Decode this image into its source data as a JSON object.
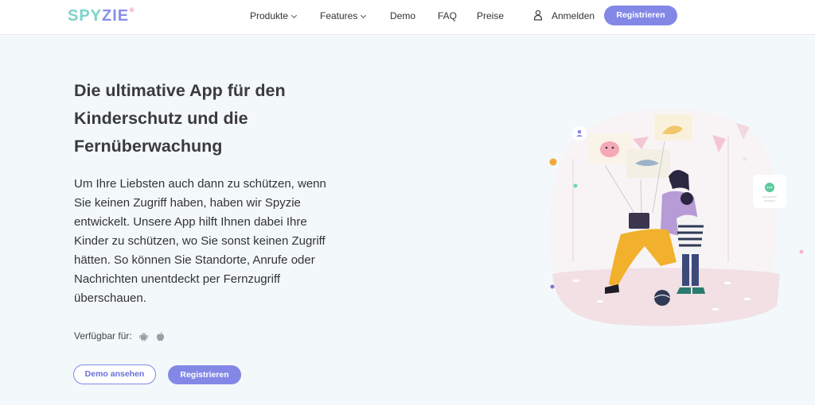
{
  "header": {
    "logo_part1": "SPY",
    "logo_part2": "ZIE",
    "logo_mark": "®",
    "nav": [
      {
        "label": "Produkte",
        "dropdown": true
      },
      {
        "label": "Features",
        "dropdown": true
      },
      {
        "label": "Demo",
        "dropdown": false
      },
      {
        "label": "FAQ",
        "dropdown": false
      },
      {
        "label": "Preise",
        "dropdown": false
      }
    ],
    "login_label": "Anmelden",
    "login_icon": "user-icon",
    "register_label": "Registrieren"
  },
  "hero": {
    "title_lines": [
      "Die ultimative App für den",
      "Kinderschutz und die",
      "Fernüberwachung"
    ],
    "text_lines": [
      "Um Ihre Liebsten auch dann zu schützen, wenn",
      "Sie keinen Zugriff haben, haben wir Spyzie",
      "entwickelt. Unsere App hilft Ihnen dabei Ihre",
      "Kinder zu schützen, wo Sie sonst keinen Zugriff",
      "hätten. So können Sie Standorte, Anrufe oder",
      "Nachrichten unentdeckt per Fernzugriff",
      "überschauen."
    ],
    "available_label": "Verfügbar für:",
    "platform_icons": [
      "android-icon",
      "apple-icon"
    ],
    "demo_button": "Demo ansehen",
    "register_button": "Registrieren"
  },
  "colors": {
    "accent": "#8388e6",
    "logo_teal": "#7bd3c8",
    "logo_purple": "#8a8ee8",
    "background": "#f3f8fb"
  }
}
